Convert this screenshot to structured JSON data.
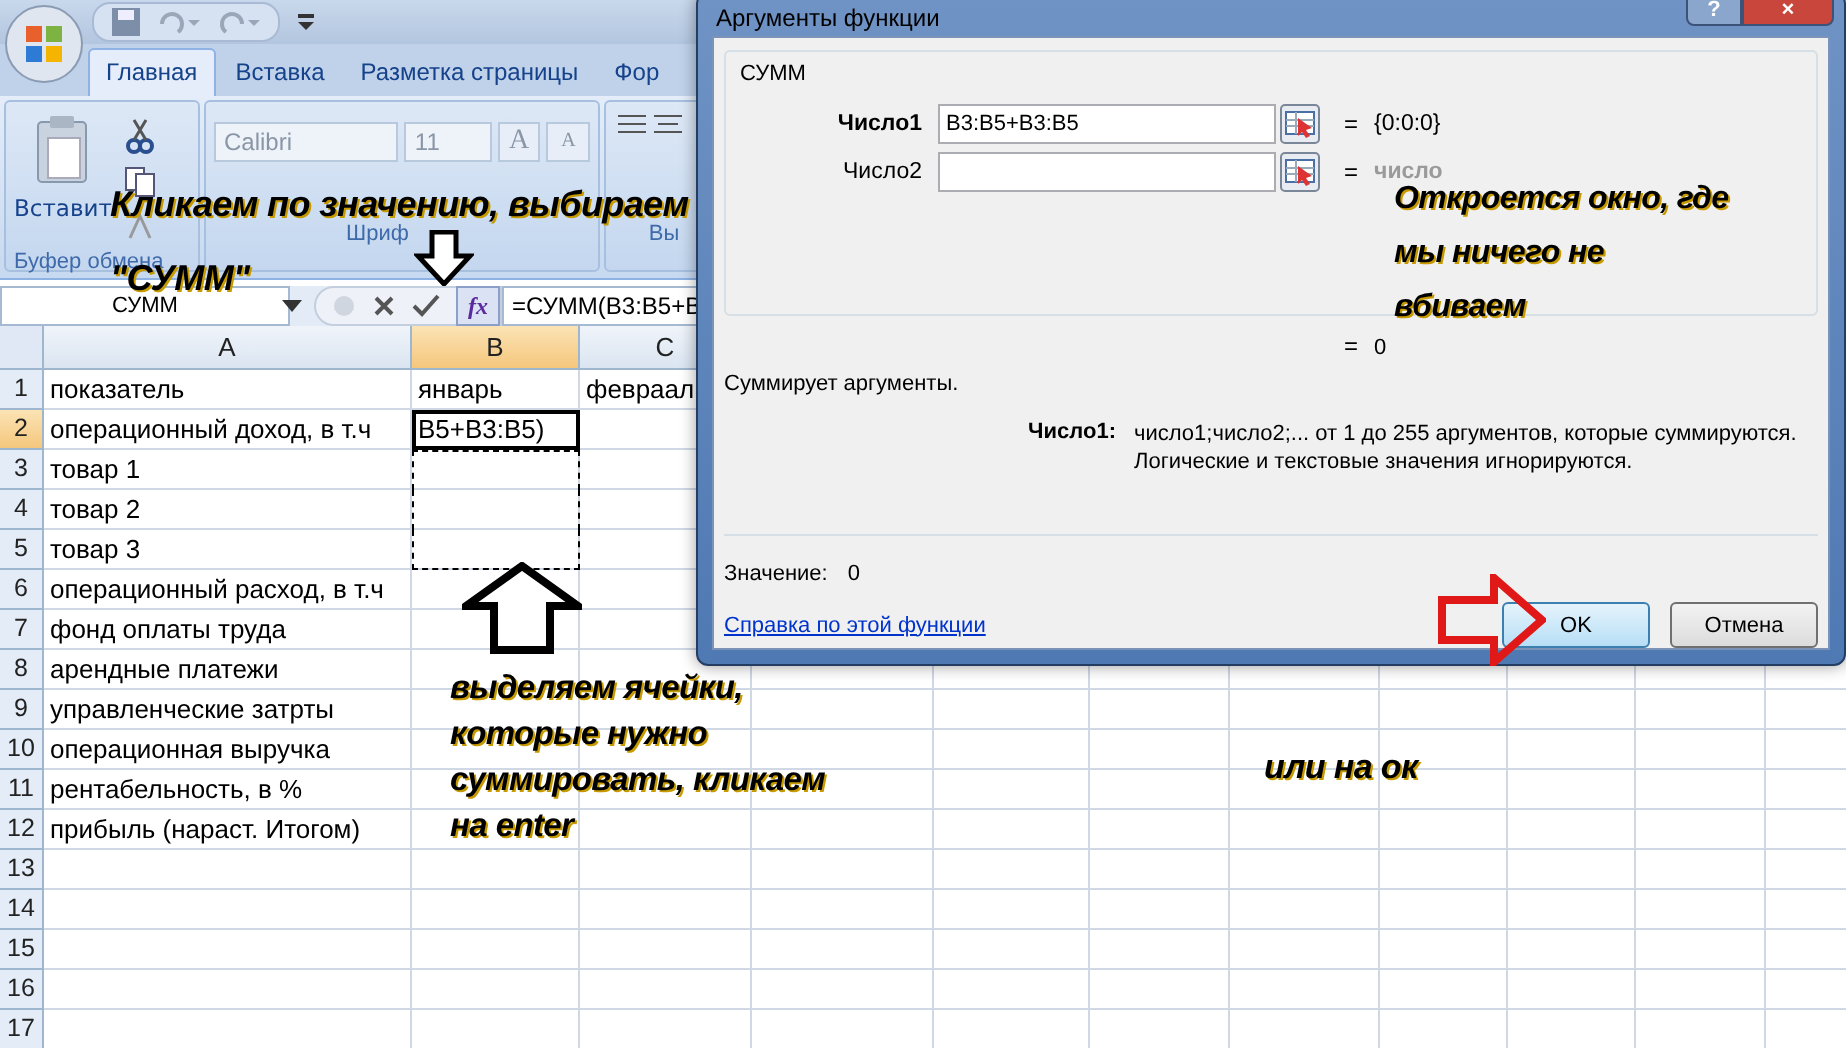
{
  "ribbon": {
    "tabs": [
      {
        "label": "Главная",
        "selected": true
      },
      {
        "label": "Вставка",
        "selected": false
      },
      {
        "label": "Разметка страницы",
        "selected": false
      },
      {
        "label": "Фор",
        "selected": false
      }
    ],
    "clipboard": {
      "paste_label": "Вставит",
      "group_label": "Буфер обмена"
    },
    "font": {
      "font_name": "Calibri",
      "font_size": "11",
      "grow_label": "A",
      "shrink_label": "A",
      "group_label": "Шриф"
    },
    "alignment": {
      "group_label": "Вы"
    }
  },
  "formula_bar": {
    "name_box": "СУММ",
    "fx_label": "fx",
    "formula": "=СУММ(B3:B5+B"
  },
  "sheet": {
    "columns": [
      {
        "label": "A",
        "selected": false
      },
      {
        "label": "B",
        "selected": true
      },
      {
        "label": "C",
        "selected": false
      }
    ],
    "rows": [
      {
        "number": "1",
        "selected": false,
        "marked": false,
        "cells": [
          "показатель",
          "январь",
          "февраал"
        ]
      },
      {
        "number": "2",
        "selected": true,
        "marked": false,
        "cells": [
          "операционный доход, в т.ч",
          "B5+B3:B5)"
        ]
      },
      {
        "number": "3",
        "selected": false,
        "marked": true,
        "cells": [
          "товар 1"
        ]
      },
      {
        "number": "4",
        "selected": false,
        "marked": true,
        "cells": [
          "товар 2"
        ]
      },
      {
        "number": "5",
        "selected": false,
        "marked": true,
        "cells": [
          "товар 3"
        ]
      },
      {
        "number": "6",
        "selected": false,
        "marked": false,
        "cells": [
          "операционный расход, в т.ч"
        ]
      },
      {
        "number": "7",
        "selected": false,
        "marked": false,
        "cells": [
          "фонд оплаты труда"
        ]
      },
      {
        "number": "8",
        "selected": false,
        "marked": false,
        "cells": [
          "арендные платежи"
        ]
      },
      {
        "number": "9",
        "selected": false,
        "marked": false,
        "cells": [
          "управленческие затрты"
        ]
      },
      {
        "number": "10",
        "selected": false,
        "marked": false,
        "cells": [
          "операционная выручка"
        ]
      },
      {
        "number": "11",
        "selected": false,
        "marked": false,
        "cells": [
          "рентабельность, в %"
        ]
      },
      {
        "number": "12",
        "selected": false,
        "marked": false,
        "cells": [
          "прибыль (нараст. Итогом)"
        ]
      },
      {
        "number": "13",
        "selected": false,
        "marked": false,
        "cells": []
      },
      {
        "number": "14",
        "selected": false,
        "marked": false,
        "cells": []
      },
      {
        "number": "15",
        "selected": false,
        "marked": false,
        "cells": []
      },
      {
        "number": "16",
        "selected": false,
        "marked": false,
        "cells": []
      },
      {
        "number": "17",
        "selected": false,
        "marked": false,
        "cells": []
      }
    ]
  },
  "dialog": {
    "title": "Аргументы функции",
    "help_label": "?",
    "close_label": "×",
    "function_name": "СУММ",
    "arguments": [
      {
        "label": "Число1",
        "active": true,
        "value": "B3:B5+B3:B5",
        "sign": "=",
        "result": "{0:0:0}",
        "result_muted": false
      },
      {
        "label": "Число2",
        "active": false,
        "sign": "=",
        "result": "число",
        "result_muted": true
      }
    ],
    "formula_result": {
      "sign": "=",
      "value": "0"
    },
    "description": "Суммирует аргументы.",
    "argument_help": {
      "label": "Число1:",
      "lines": [
        "число1;число2;... от 1 до 255 аргументов, которые суммируются.",
        "Логические и текстовые значения игнорируются."
      ]
    },
    "value": {
      "label": "Значение:",
      "value": "0"
    },
    "help_link": "Справка по этой функции",
    "buttons": [
      {
        "label": "OK",
        "focused": true
      },
      {
        "label": "Отмена",
        "focused": false
      }
    ]
  },
  "annotations": [
    {
      "lines": [
        "Кликаем по значению,  выбираем",
        "\"СУММ\""
      ]
    },
    {
      "lines": [
        "Откроется окно, где",
        "мы ничего не",
        "вбиваем"
      ]
    },
    {
      "lines": [
        "выделяем ячейки,",
        "которые нужно",
        "суммировать, кликаем",
        "на enter"
      ]
    },
    {
      "lines": [
        "или на ок"
      ]
    }
  ]
}
